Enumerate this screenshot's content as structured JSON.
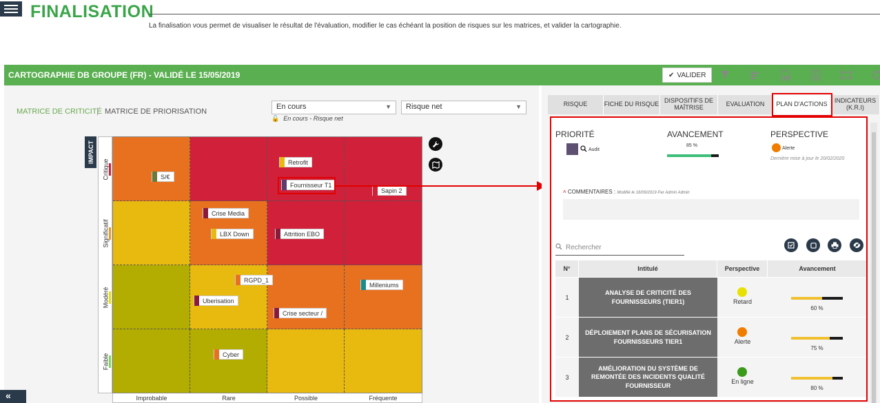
{
  "header": {
    "title": "FINALISATION",
    "subtitle": "La finalisation vous permet de visualiser le résultat de l'évaluation, modifier le cas échéant la position de risques sur les matrices, et valider la cartographie."
  },
  "greenbar": {
    "title": "CARTOGRAPHIE DB GROUPE (FR) - VALIDÉ LE 15/05/2019",
    "valider_label": "VALIDER",
    "icons": [
      "filter-icon",
      "hierarchy-icon",
      "image-export-icon",
      "pdf-export-icon",
      "fit-screen-icon",
      "refresh-icon"
    ]
  },
  "matrix": {
    "tab_criticite": "MATRICE DE CRITICITÉ",
    "tab_priorisation": "MATRICE DE PRIORISATION",
    "select_status": "En cours",
    "select_risk": "Risque net",
    "lock_note": "En cours - Risque net",
    "impact_label": "IMPACT",
    "y_levels": [
      "Critique",
      "Significatif",
      "Modéré",
      "Faible"
    ],
    "x_levels": [
      "Improbable",
      "Rare",
      "Possible",
      "Fréquente"
    ],
    "colors": {
      "dark_red": "#d0203a",
      "orange": "#e8711f",
      "amber": "#e89a1f",
      "yellow": "#e8b90f",
      "olive": "#b2ad00"
    },
    "risks": [
      {
        "label": "S/€",
        "color": "#6b7a3a"
      },
      {
        "label": "Retrofit",
        "color": "#e8b90f"
      },
      {
        "label": "Fournisseur T1",
        "color": "#5e3a6e"
      },
      {
        "label": "Sapin 2",
        "color": "#d0203a"
      },
      {
        "label": "Crise Media",
        "color": "#8b1a3a"
      },
      {
        "label": "LBX Down",
        "color": "#e8b90f"
      },
      {
        "label": "Attrition EBO",
        "color": "#8b1a3a"
      },
      {
        "label": "RGPD_1",
        "color": "#e8711f"
      },
      {
        "label": "Milleniums",
        "color": "#1a8a8a"
      },
      {
        "label": "Uberisation",
        "color": "#8b1a3a"
      },
      {
        "label": "Crise secteur /",
        "color": "#8b1a3a"
      },
      {
        "label": "Cyber",
        "color": "#e8711f"
      }
    ]
  },
  "tabs": [
    {
      "label": "RISQUE"
    },
    {
      "label": "FICHE DU RISQUE"
    },
    {
      "label": "DISPOSITIFS DE MAÎTRISE"
    },
    {
      "label": "EVALUATION"
    },
    {
      "label": "PLAN D'ACTIONS"
    },
    {
      "label": "INDICATEURS (K.R.I)"
    }
  ],
  "plan": {
    "priorite_label": "PRIORITÉ",
    "priorite_tag": "Audit",
    "priorite_color": "#5e5070",
    "avancement_label": "AVANCEMENT",
    "avancement_value": "85 %",
    "avancement_fraction": 0.85,
    "avancement_color": "#3dbe7a",
    "perspective_label": "PERSPECTIVE",
    "perspective_status": "Alerte",
    "perspective_color": "#f07d00",
    "perspective_updated": "Dernière mise à jour le 20/02/2020",
    "comments_label": "COMMENTAIRES :",
    "comments_meta": "Modifié le 16/09/2019 Par Admin Admin",
    "search_placeholder": "Rechercher",
    "table_headers": [
      "N°",
      "Intitulé",
      "Perspective",
      "Avancement"
    ],
    "rows": [
      {
        "num": "1",
        "title": "ANALYSE DE CRITICITÉ DES FOURNISSEURS (TIER1)",
        "status": "Retard",
        "status_color": "#e8e000",
        "progress_label": "60 %",
        "progress": 0.6
      },
      {
        "num": "2",
        "title": "DÉPLOIEMENT PLANS DE SÉCURISATION FOURNISSEURS TIER1",
        "status": "Alerte",
        "status_color": "#f07d00",
        "progress_label": "75 %",
        "progress": 0.75
      },
      {
        "num": "3",
        "title": "AMÉLIORATION DU SYSTÈME DE REMONTÉE DES INCIDENTS QUALITÉ FOURNISSEUR",
        "status": "En ligne",
        "status_color": "#3a9a1a",
        "progress_label": "80 %",
        "progress": 0.8
      }
    ],
    "bar_fill_color": "#f0c030"
  },
  "nav": {
    "collapse_label": "«"
  }
}
